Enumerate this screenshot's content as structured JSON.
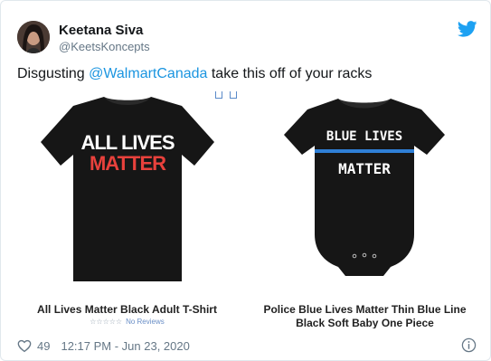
{
  "author": {
    "name": "Keetana Siva",
    "handle": "@KeetsKoncepts"
  },
  "tweet": {
    "text_before": "Disgusting ",
    "mention": "@WalmartCanada",
    "text_after": " take this off of your racks"
  },
  "products": [
    {
      "title": "All Lives Matter Black Adult T-Shirt",
      "print_line1": "ALL LIVES",
      "print_line2": "MATTER",
      "reviews_label": "No Reviews"
    },
    {
      "title_line1": "Police Blue Lives Matter Thin Blue Line",
      "title_line2": "Black Soft Baby One Piece",
      "print_line1": "BLUE LIVES",
      "print_line2": "MATTER"
    }
  ],
  "footer": {
    "likes": "49",
    "timestamp": "12:17 PM - Jun 23, 2020"
  },
  "icons": {
    "brand": "twitter-bird-icon",
    "like": "heart-icon",
    "info": "info-icon"
  },
  "colors": {
    "mention": "#1b95e0",
    "twitter_blue": "#1da1f2",
    "print_red": "#e8413c",
    "thin_blue_line": "#2f7fd6"
  }
}
